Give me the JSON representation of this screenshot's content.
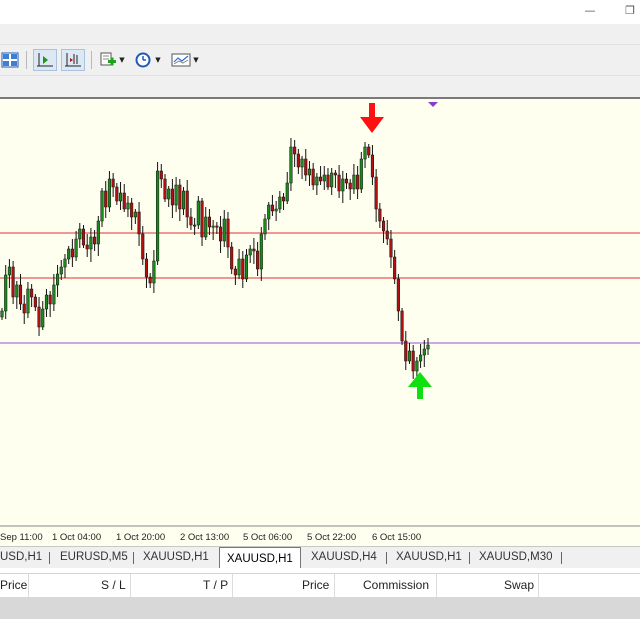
{
  "window": {
    "minimize_glyph": "—",
    "restore_glyph": "❐"
  },
  "toolbar": {
    "icons": [
      "tile-windows-icon",
      "chart-shift-icon",
      "auto-scroll-icon",
      "indicators-icon",
      "periods-icon",
      "templates-icon"
    ]
  },
  "chart": {
    "symbol": "XAUUSD,H1",
    "time_labels": [
      "Sep 11:00",
      "1 Oct 04:00",
      "1 Oct 20:00",
      "2 Oct 13:00",
      "5 Oct 06:00",
      "5 Oct 22:00",
      "6 Oct 15:00"
    ],
    "colors": {
      "background": "#fffff0",
      "bull_candle": "#1a8a1a",
      "bear_candle": "#b01010",
      "resistance_line": "#e03030",
      "support_line": "#9a50d0",
      "sell_arrow": "#ff1010",
      "buy_arrow": "#10e010"
    },
    "signals": [
      {
        "type": "sell",
        "shape": "down-arrow",
        "color": "red"
      },
      {
        "type": "buy",
        "shape": "up-arrow",
        "color": "green"
      }
    ]
  },
  "tabs": [
    {
      "label": "USD,H1",
      "active": false
    },
    {
      "label": "EURUSD,M5",
      "active": false
    },
    {
      "label": "XAUUSD,H1",
      "active": false
    },
    {
      "label": "XAUUSD,H1",
      "active": true
    },
    {
      "label": "XAUUSD,H4",
      "active": false
    },
    {
      "label": "XAUUSD,H1",
      "active": false
    },
    {
      "label": "XAUUSD,M30",
      "active": false
    }
  ],
  "terminal": {
    "columns": [
      "Price",
      "S / L",
      "T / P",
      "Price",
      "Commission",
      "Swap"
    ]
  }
}
